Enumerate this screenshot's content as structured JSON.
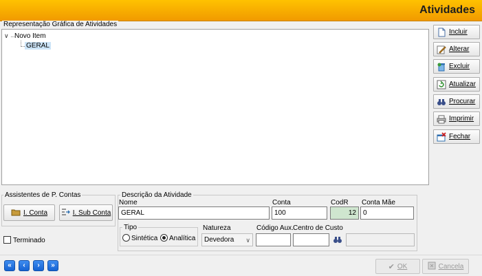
{
  "window": {
    "title": "Atividades"
  },
  "tree_group": {
    "label": "Representação Gráfica de Atividades",
    "items": [
      {
        "label": "Novo Item",
        "expanded": true
      },
      {
        "label": "GERAL",
        "selected": true
      }
    ]
  },
  "side_buttons": [
    {
      "label": "Incluir",
      "icon": "new-document-icon"
    },
    {
      "label": "Alterar",
      "icon": "edit-pencil-icon"
    },
    {
      "label": "Excluir",
      "icon": "delete-bin-icon"
    },
    {
      "label": "Atualizar",
      "icon": "refresh-icon"
    },
    {
      "label": "Procurar",
      "icon": "binoculars-icon"
    },
    {
      "label": "Imprimir",
      "icon": "printer-icon"
    },
    {
      "label": "Fechar",
      "icon": "close-window-icon"
    }
  ],
  "assistentes": {
    "label": "Assistentes de P. Contas",
    "conta_button": "I. Conta",
    "subconta_button": "I. Sub Conta"
  },
  "terminado": {
    "label": "Terminado",
    "checked": false
  },
  "descricao": {
    "group_label": "Descrição da Atividade",
    "nome_label": "Nome",
    "nome_value": "GERAL",
    "conta_label": "Conta",
    "conta_value": "100",
    "codr_label": "CodR",
    "codr_value": "12",
    "conta_mae_label": "Conta Mãe",
    "conta_mae_value": "0",
    "tipo_label": "Tipo",
    "tipo_options": [
      "Sintética",
      "Analítica"
    ],
    "tipo_selected": "Analítica",
    "natureza_label": "Natureza",
    "natureza_value": "Devedora",
    "codigo_aux_label": "Código Aux.",
    "codigo_aux_value": "",
    "centro_custo_label": "Centro de Custo",
    "centro_custo_value": "",
    "centro_custo_desc": ""
  },
  "navigation": [
    {
      "name": "first-record",
      "glyph": "«"
    },
    {
      "name": "previous-record",
      "glyph": "‹"
    },
    {
      "name": "next-record",
      "glyph": "›"
    },
    {
      "name": "last-record",
      "glyph": "»"
    }
  ],
  "footer": {
    "ok_label": "OK",
    "cancel_label": "Cancela"
  }
}
